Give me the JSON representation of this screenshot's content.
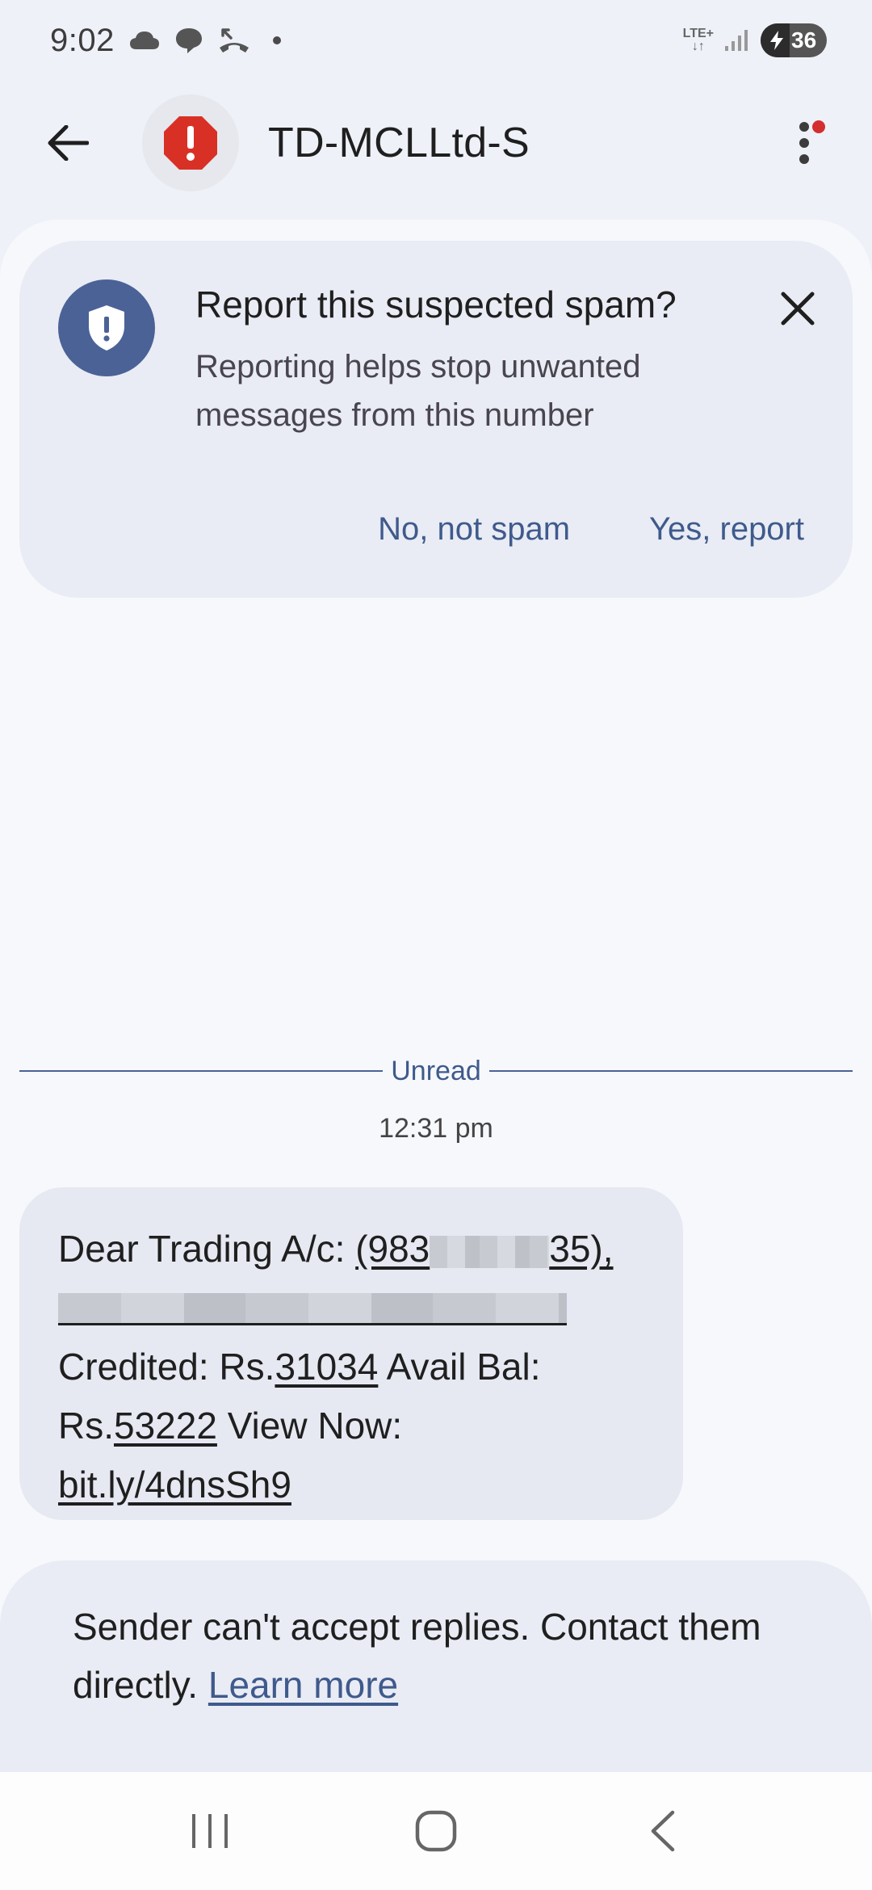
{
  "status_bar": {
    "time": "9:02",
    "network": "LTE+",
    "battery_level": "36",
    "icons": [
      "cloud-icon",
      "chat-bubble-icon",
      "missed-call-icon",
      "dot-icon",
      "lte-icon",
      "signal-icon",
      "battery-charging-icon"
    ]
  },
  "header": {
    "title": "TD-MCLLtd-S",
    "back_icon": "arrow-left-icon",
    "avatar_icon": "spam-stop-icon",
    "menu_icon": "more-vert-icon"
  },
  "spam_prompt": {
    "title": "Report this suspected spam?",
    "body": "Reporting helps stop unwanted messages from this number",
    "no_label": "No, not spam",
    "yes_label": "Yes, report",
    "icon": "shield-alert-icon",
    "close_icon": "close-icon"
  },
  "conversation": {
    "divider_label": "Unread",
    "timestamp": "12:31 pm",
    "message": {
      "prefix": "Dear Trading A/c: ",
      "account_start": "(983",
      "account_end": "35),",
      "credited_label": "Credited: Rs.",
      "credited_amount": "31034",
      "avail_label": " Avail Bal: Rs.",
      "avail_amount": "53222",
      "view_label": " View Now: ",
      "link": "bit.ly/4dnsSh9"
    }
  },
  "footer": {
    "text": "Sender can't accept replies. Contact them directly. ",
    "link": "Learn more"
  },
  "colors": {
    "accent": "#3f5a8c",
    "shield": "#4b6297",
    "spam_red": "#d93025",
    "background": "#eef1f8"
  }
}
